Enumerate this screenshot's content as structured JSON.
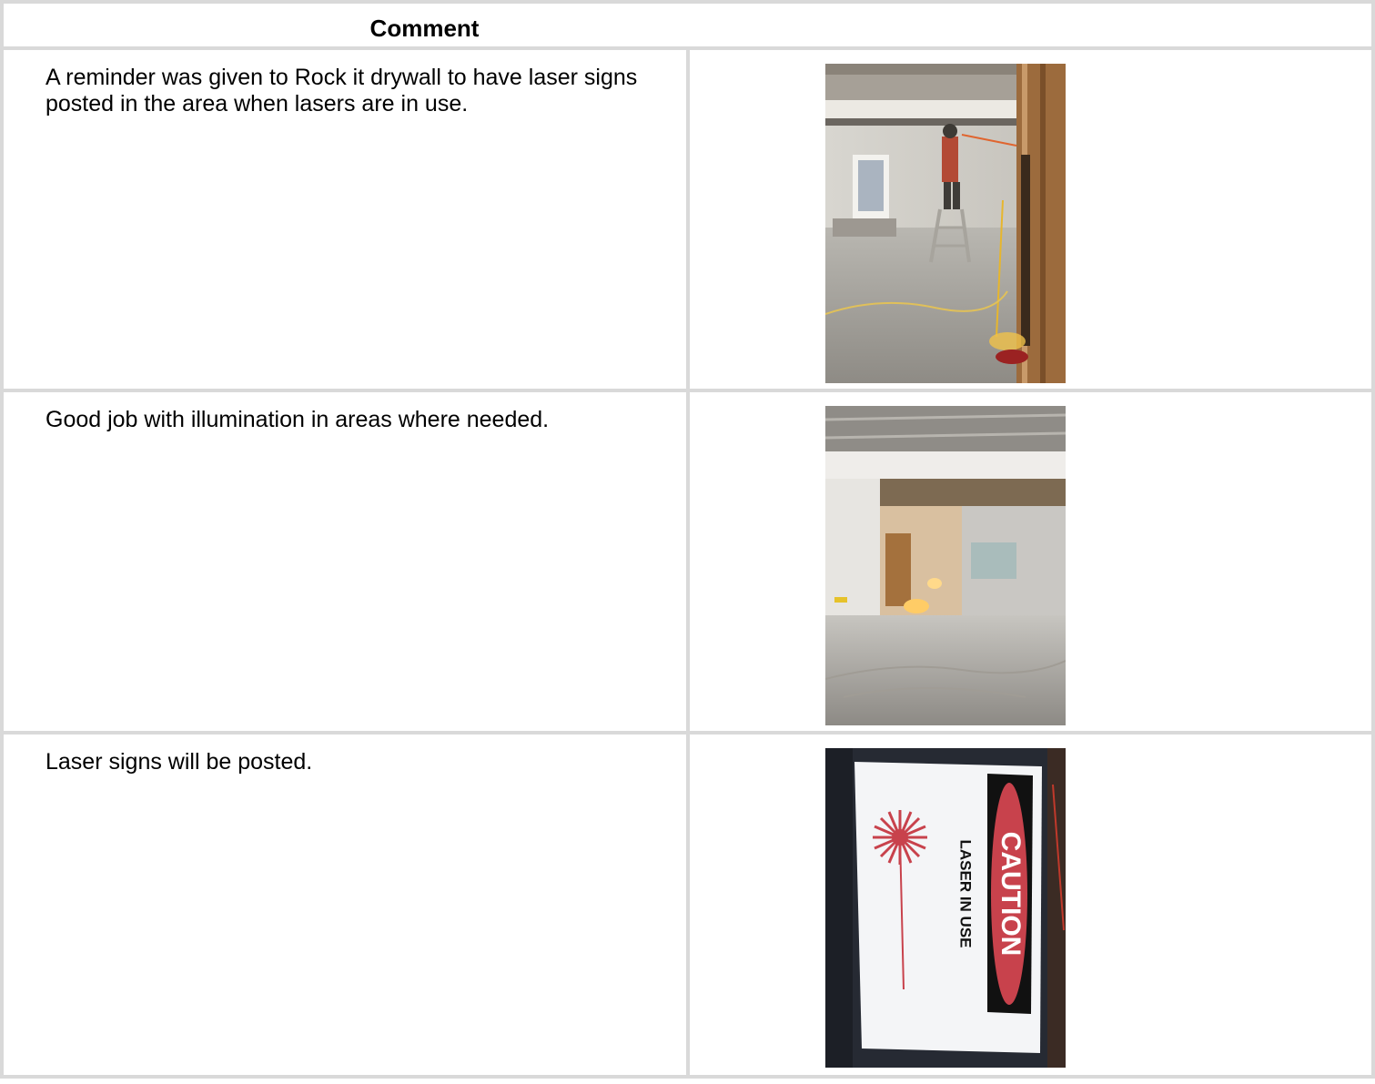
{
  "table": {
    "header": "Comment",
    "rows": [
      {
        "comment": "A reminder was given to Rock it drywall to have laser signs posted in the area when lasers are in use.",
        "photo": "construction-worker-on-ladder-photo"
      },
      {
        "comment": "Good job with illumination in areas where needed.",
        "photo": "illuminated-construction-area-photo"
      },
      {
        "comment": "Laser signs will be posted.",
        "photo": "laser-caution-sign-photo"
      }
    ]
  },
  "sign": {
    "caution": "CAUTION",
    "laser_in_use": "LASER IN USE"
  },
  "colors": {
    "border": "#d9d9d9",
    "sign_red": "#c8424c"
  }
}
